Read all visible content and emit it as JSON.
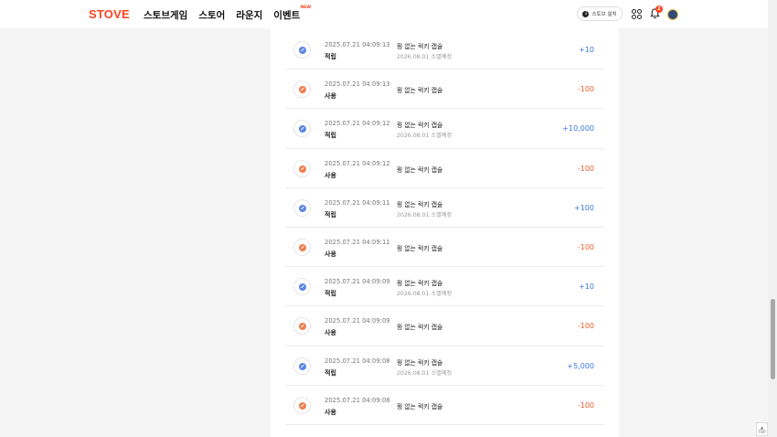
{
  "header": {
    "logo": "STOVE",
    "nav": [
      {
        "label": "스토브게임"
      },
      {
        "label": "스토어"
      },
      {
        "label": "라운지"
      },
      {
        "label": "이벤트",
        "badge": "NEW"
      }
    ],
    "launcher_label": "스토브 설치",
    "notification_count": "2"
  },
  "history": [
    {
      "kind": "earn",
      "date": "2025.07.21 04:09:13",
      "type": "적립",
      "title": "뭥 없는 럭키 캡슐",
      "expiry": "2026.08.01 소멸예정",
      "amount": "+10"
    },
    {
      "kind": "use",
      "date": "2025.07.21 04:09:13",
      "type": "사용",
      "title": "뭥 없는 럭키 캡슐",
      "expiry": "",
      "amount": "-100"
    },
    {
      "kind": "earn",
      "date": "2025.07.21 04:09:12",
      "type": "적립",
      "title": "뭥 없는 럭키 캡슐",
      "expiry": "2026.08.01 소멸예정",
      "amount": "+10,000"
    },
    {
      "kind": "use",
      "date": "2025.07.21 04:09:12",
      "type": "사용",
      "title": "뭥 없는 럭키 캡슐",
      "expiry": "",
      "amount": "-100"
    },
    {
      "kind": "earn",
      "date": "2025.07.21 04:09:11",
      "type": "적립",
      "title": "뭥 없는 럭키 캡슐",
      "expiry": "2026.08.01 소멸예정",
      "amount": "+100"
    },
    {
      "kind": "use",
      "date": "2025.07.21 04:09:11",
      "type": "사용",
      "title": "뭥 없는 럭키 캡슐",
      "expiry": "",
      "amount": "-100"
    },
    {
      "kind": "earn",
      "date": "2025.07.21 04:09:09",
      "type": "적립",
      "title": "뭥 없는 럭키 캡슐",
      "expiry": "2026.08.01 소멸예정",
      "amount": "+10"
    },
    {
      "kind": "use",
      "date": "2025.07.21 04:09:09",
      "type": "사용",
      "title": "뭥 없는 럭키 캡슐",
      "expiry": "",
      "amount": "-100"
    },
    {
      "kind": "earn",
      "date": "2025.07.21 04:09:08",
      "type": "적립",
      "title": "뭥 없는 럭키 캡슐",
      "expiry": "2026.08.01 소멸예정",
      "amount": "+5,000"
    },
    {
      "kind": "use",
      "date": "2025.07.21 04:09:08",
      "type": "사용",
      "title": "뭥 없는 럭키 캡슐",
      "expiry": "",
      "amount": "-100"
    }
  ],
  "top_button_label": "TOP",
  "colors": {
    "brand": "#fc4420",
    "earn": "#3a78e0",
    "use": "#ef5a2e"
  }
}
